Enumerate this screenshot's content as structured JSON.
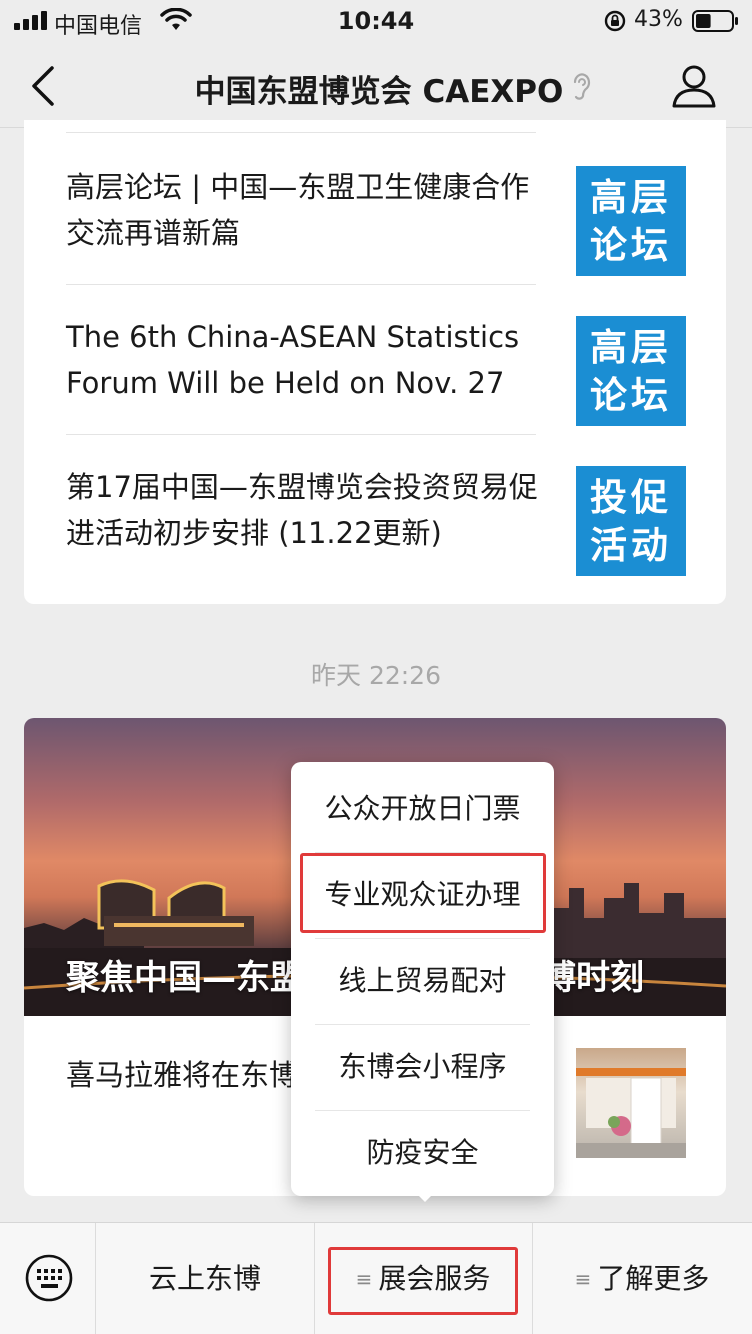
{
  "status_bar": {
    "carrier": "中国电信",
    "time": "10:44",
    "battery_percent": "43%",
    "battery_level": 0.43
  },
  "nav": {
    "title": "中国东盟博览会 CAEXPO",
    "back_icon": "chevron-left-icon",
    "profile_icon": "person-icon"
  },
  "articles": [
    {
      "title": "高层论坛 | 中国—东盟卫生健康合作交流再谱新篇",
      "thumb_line1": "高层",
      "thumb_line2": "论坛"
    },
    {
      "title": "The 6th China-ASEAN Statistics Forum Will be Held on Nov. 27",
      "thumb_line1": "高层",
      "thumb_line2": "论坛"
    },
    {
      "title": "第17届中国—东盟博览会投资贸易促进活动初步安排 (11.22更新)",
      "thumb_line1": "投促",
      "thumb_line2": "活动"
    }
  ],
  "timestamp": "昨天 22:26",
  "feature": {
    "hero_title": "聚焦中国—东盟博览会，共享东博时刻",
    "sub_article": "喜马拉雅将在东博会现场“活”"
  },
  "popup_menu": {
    "items": [
      "公众开放日门票",
      "专业观众证办理",
      "线上贸易配对",
      "东博会小程序",
      "防疫安全"
    ],
    "highlighted_index": 1
  },
  "bottom_menu": {
    "keyboard_icon": "keyboard-icon",
    "items": [
      "云上东博",
      "展会服务",
      "了解更多"
    ],
    "highlighted_index": 1
  },
  "colors": {
    "thumb_blue": "#1b8ed3",
    "highlight_red": "#e03a3a"
  }
}
